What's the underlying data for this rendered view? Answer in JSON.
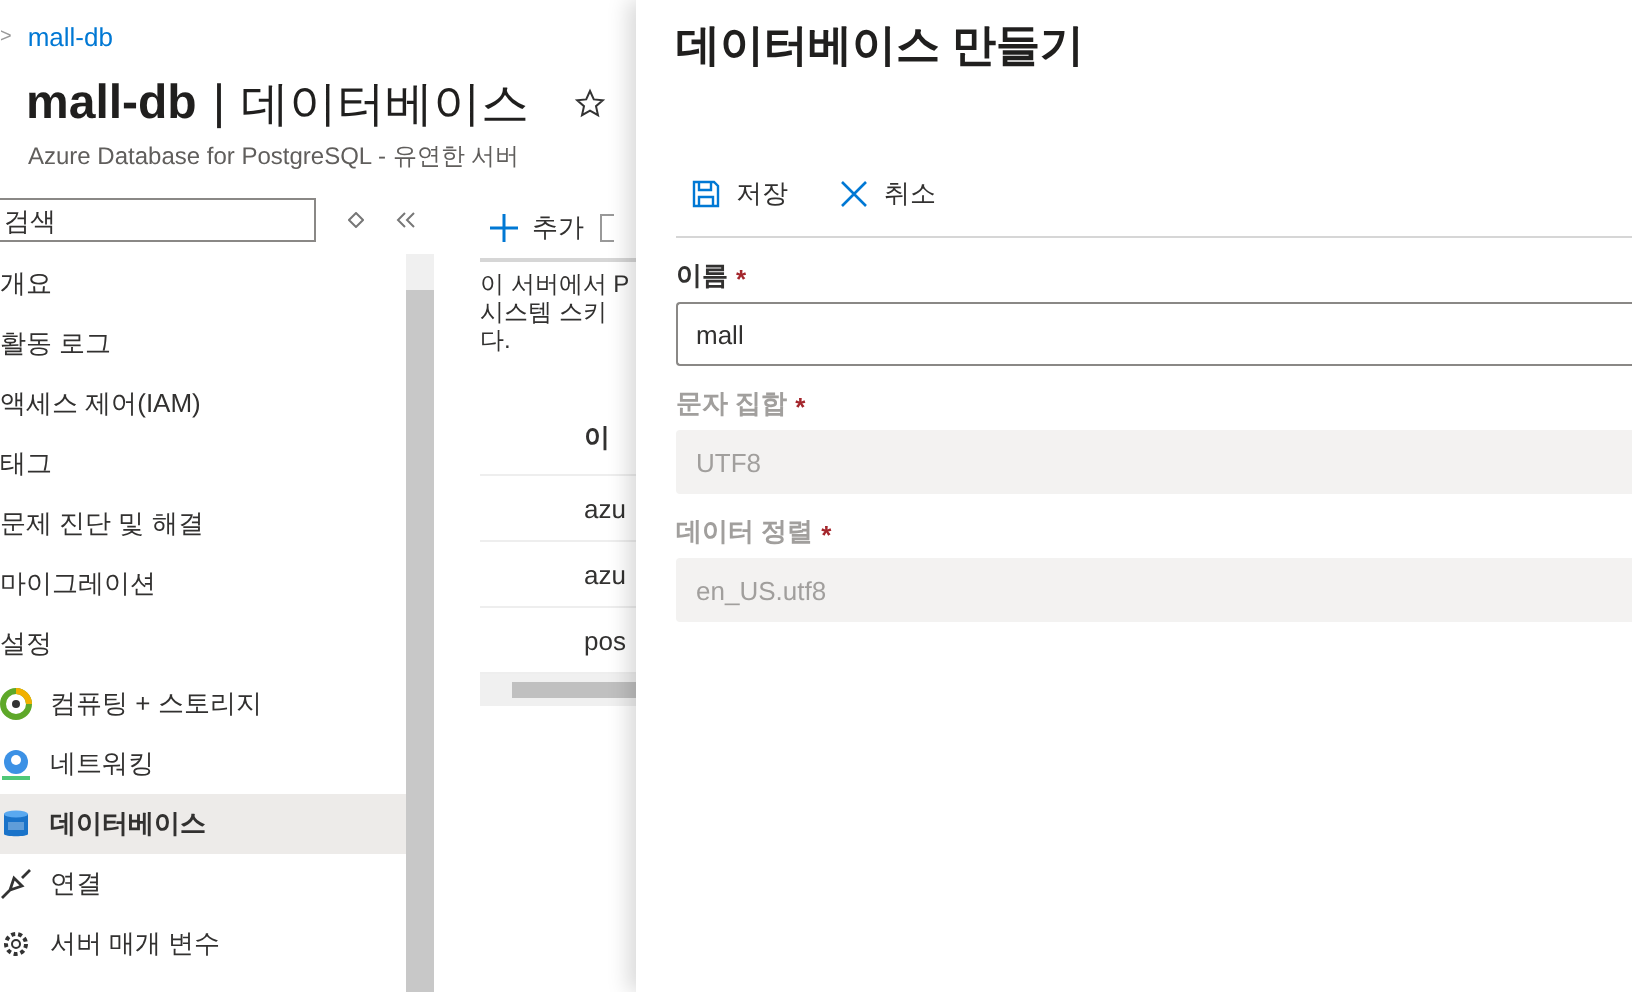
{
  "breadcrumb": {
    "separator": ">",
    "link": "mall-db"
  },
  "title": {
    "resource": "mall-db",
    "separator": "|",
    "page": "데이터베이스",
    "favorite": false
  },
  "subtitle": "Azure Database for PostgreSQL - 유연한 서버",
  "sidebar": {
    "search": {
      "placeholder": "검색"
    },
    "items": [
      {
        "label": "개요",
        "selected": false
      },
      {
        "label": "활동 로그",
        "selected": false
      },
      {
        "label": "액세스 제어(IAM)",
        "selected": false
      },
      {
        "label": "태그",
        "selected": false
      },
      {
        "label": "문제 진단 및 해결",
        "selected": false
      },
      {
        "label": "마이그레이션",
        "selected": false
      },
      {
        "label": "설정",
        "selected": false,
        "children": [
          {
            "label": "컴퓨팅 + 스토리지",
            "selected": false
          },
          {
            "label": "네트워킹",
            "selected": false
          },
          {
            "label": "데이터베이스",
            "selected": true
          },
          {
            "label": "연결",
            "selected": false
          },
          {
            "label": "서버 매개 변수",
            "selected": false
          }
        ]
      }
    ]
  },
  "toolbar": {
    "add": "추가"
  },
  "description_lines": [
    "이 서버에서 P",
    "시스템 스키",
    "다."
  ],
  "table": {
    "column_1": "이",
    "rows": [
      "azu",
      "azu",
      "pos"
    ]
  },
  "panel": {
    "title": "데이터베이스 만들기",
    "save": "저장",
    "cancel": "취소",
    "fields": [
      {
        "label": "이름",
        "required_mark": "*",
        "value": "mall",
        "disabled": false
      },
      {
        "label": "문자 집합",
        "required_mark": "*",
        "value": "UTF8",
        "disabled": true
      },
      {
        "label": "데이터 정렬",
        "required_mark": "*",
        "value": "en_US.utf8",
        "disabled": true
      }
    ]
  }
}
